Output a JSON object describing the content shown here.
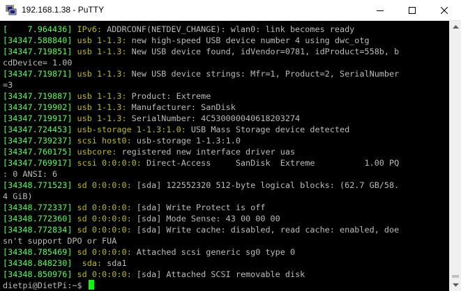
{
  "window": {
    "title": "192.168.1.38 - PuTTY"
  },
  "icons": {
    "app": "putty-icon",
    "minimize": "minimize-icon",
    "maximize": "maximize-icon",
    "close": "close-icon",
    "scroll_up": "scroll-up-arrow-icon",
    "scroll_down": "scroll-down-arrow-icon"
  },
  "terminal": {
    "lines": [
      {
        "ts": "[    7.964436]",
        "src": "IPv6:",
        "msg": " ADDRCONF(NETDEV_CHANGE): wlan0: link becomes ready"
      },
      {
        "ts": "[34347.588840]",
        "src": "usb 1-1.3:",
        "msg": " new high-speed USB device number 4 using dwc_otg"
      },
      {
        "ts": "[34347.719851]",
        "src": "usb 1-1.3:",
        "msg": " New USB device found, idVendor=0781, idProduct=558b, b"
      },
      {
        "ts": "",
        "src": "",
        "msg": "cdDevice= 1.00"
      },
      {
        "ts": "[34347.719871]",
        "src": "usb 1-1.3:",
        "msg": " New USB device strings: Mfr=1, Product=2, SerialNumber"
      },
      {
        "ts": "",
        "src": "",
        "msg": "=3"
      },
      {
        "ts": "[34347.719887]",
        "src": "usb 1-1.3:",
        "msg": " Product: Extreme"
      },
      {
        "ts": "[34347.719902]",
        "src": "usb 1-1.3:",
        "msg": " Manufacturer: SanDisk"
      },
      {
        "ts": "[34347.719917]",
        "src": "usb 1-1.3:",
        "msg": " SerialNumber: 4C530000040618203274"
      },
      {
        "ts": "[34347.724453]",
        "src": "usb-storage 1-1.3:1.0:",
        "msg": " USB Mass Storage device detected"
      },
      {
        "ts": "[34347.739237]",
        "src": "scsi host0:",
        "msg": " usb-storage 1-1.3:1.0"
      },
      {
        "ts": "[34347.760175]",
        "src": "usbcore:",
        "msg": " registered new interface driver uas"
      },
      {
        "ts": "[34347.769917]",
        "src": "scsi 0:0:0:0:",
        "msg": " Direct-Access     SanDisk  Extreme          1.00 PQ"
      },
      {
        "ts": "",
        "src": "",
        "msg": ": 0 ANSI: 6"
      },
      {
        "ts": "[34348.771523]",
        "src": "sd 0:0:0:0:",
        "msg": " [sda] 122552320 512-byte logical blocks: (62.7 GB/58."
      },
      {
        "ts": "",
        "src": "",
        "msg": "4 GiB)"
      },
      {
        "ts": "[34348.772337]",
        "src": "sd 0:0:0:0:",
        "msg": " [sda] Write Protect is off"
      },
      {
        "ts": "[34348.772360]",
        "src": "sd 0:0:0:0:",
        "msg": " [sda] Mode Sense: 43 00 00 00"
      },
      {
        "ts": "[34348.772834]",
        "src": "sd 0:0:0:0:",
        "msg": " [sda] Write cache: disabled, read cache: enabled, doe"
      },
      {
        "ts": "",
        "src": "",
        "msg": "sn't support DPO or FUA"
      },
      {
        "ts": "[34348.785469]",
        "src": "sd 0:0:0:0:",
        "msg": " Attached scsi generic sg0 type 0"
      },
      {
        "ts": "[34348.848230]",
        "src": " sda:",
        "msg": " sda1"
      },
      {
        "ts": "[34348.850976]",
        "src": "sd 0:0:0:0:",
        "msg": " [sda] Attached SCSI removable disk"
      }
    ],
    "prompt": "dietpi@DietPi:~$ "
  },
  "colors": {
    "timestamp": "#55ff55",
    "source": "#bbbb00",
    "message": "#bbbbbb",
    "cursor": "#00ff00",
    "background": "#000000"
  }
}
